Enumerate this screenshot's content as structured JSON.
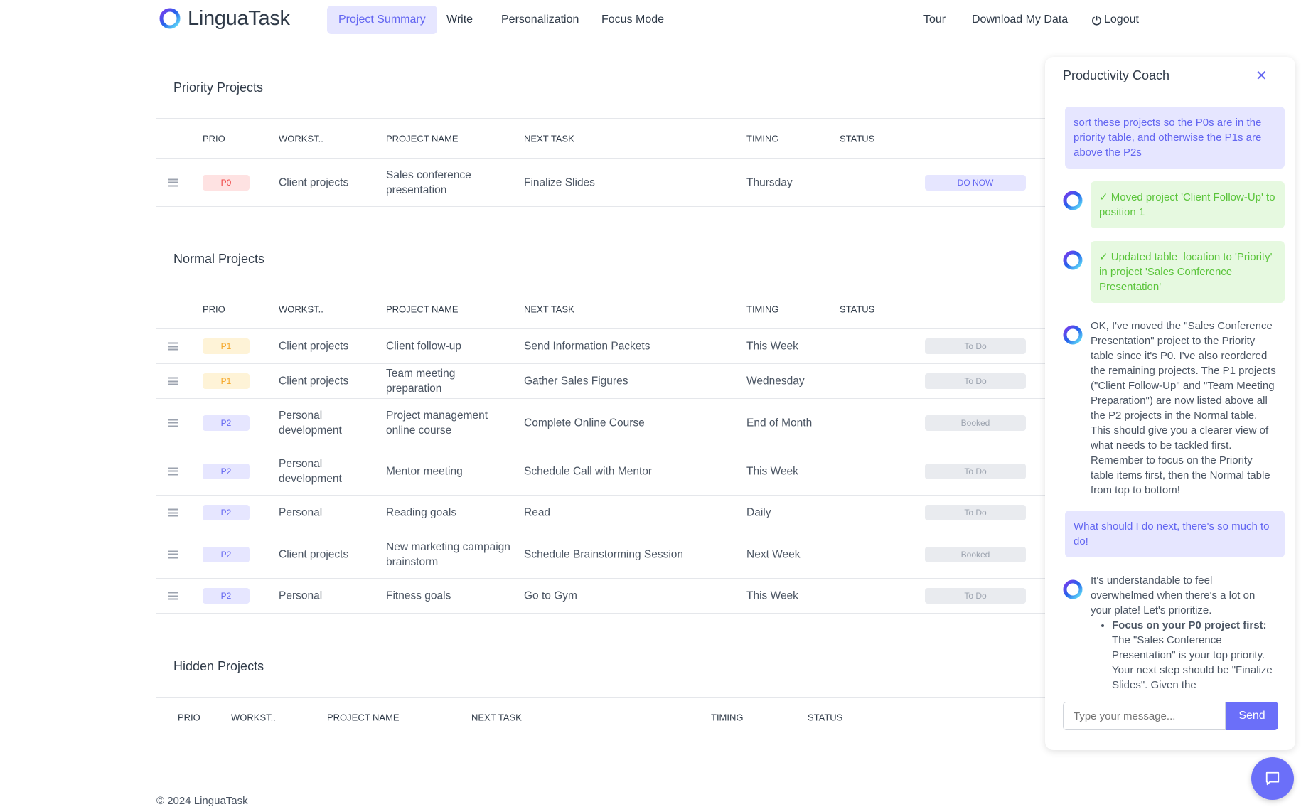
{
  "brand": {
    "name": "LinguaTask"
  },
  "nav": {
    "items": [
      "Project Summary",
      "Write",
      "Personalization",
      "Focus Mode"
    ],
    "active": "Project Summary",
    "right": {
      "tour": "Tour",
      "download": "Download My Data",
      "logout": "Logout"
    }
  },
  "columns": [
    "PRIO",
    "WORKST..",
    "PROJECT NAME",
    "NEXT TASK",
    "TIMING",
    "STATUS"
  ],
  "priority": {
    "title": "Priority Projects",
    "rows": [
      {
        "prio": "P0",
        "workstream": "Client projects",
        "project": "Sales conference presentation",
        "task": "Finalize Slides",
        "timing": "Thursday",
        "status": "DO NOW"
      }
    ]
  },
  "normal": {
    "title": "Normal Projects",
    "rows": [
      {
        "prio": "P1",
        "workstream": "Client projects",
        "project": "Client follow-up",
        "task": "Send Information Packets",
        "timing": "This Week",
        "status": "To Do"
      },
      {
        "prio": "P1",
        "workstream": "Client projects",
        "project": "Team meeting preparation",
        "task": "Gather Sales Figures",
        "timing": "Wednesday",
        "status": "To Do"
      },
      {
        "prio": "P2",
        "workstream": "Personal development",
        "project": "Project management online course",
        "task": "Complete Online Course",
        "timing": "End of Month",
        "status": "Booked"
      },
      {
        "prio": "P2",
        "workstream": "Personal development",
        "project": "Mentor meeting",
        "task": "Schedule Call with Mentor",
        "timing": "This Week",
        "status": "To Do"
      },
      {
        "prio": "P2",
        "workstream": "Personal",
        "project": "Reading goals",
        "task": "Read",
        "timing": "Daily",
        "status": "To Do"
      },
      {
        "prio": "P2",
        "workstream": "Client projects",
        "project": "New marketing campaign brainstorm",
        "task": "Schedule Brainstorming Session",
        "timing": "Next Week",
        "status": "Booked"
      },
      {
        "prio": "P2",
        "workstream": "Personal",
        "project": "Fitness goals",
        "task": "Go to Gym",
        "timing": "This Week",
        "status": "To Do"
      }
    ]
  },
  "hidden": {
    "title": "Hidden Projects",
    "rows": []
  },
  "colors": {
    "accent": "#6366f1",
    "p0_bg": "#fee2e2",
    "p0_fg": "#ef4444",
    "p1_bg": "#fef3d7",
    "p1_fg": "#f5a524",
    "p2_bg": "#e6e6ff",
    "p2_fg": "#6366f1",
    "success_bg": "#e6f9e0",
    "success_fg": "#5ac43a"
  },
  "chat": {
    "title": "Productivity Coach",
    "close_icon": "close-icon",
    "messages": [
      {
        "role": "user",
        "text": "sort these projects so the P0s are in the priority table, and otherwise the P1s are above the P2s"
      },
      {
        "role": "action",
        "text": "✓ Moved project 'Client Follow-Up' to position 1"
      },
      {
        "role": "action",
        "text": "✓ Updated table_location to 'Priority' in project 'Sales Conference Presentation'"
      },
      {
        "role": "bot",
        "text": "OK, I've moved the \"Sales Conference Presentation\" project to the Priority table since it's P0. I've also reordered the remaining projects. The P1 projects (\"Client Follow-Up\" and \"Team Meeting Preparation\") are now listed above all the P2 projects in the Normal table. This should give you a clearer view of what needs to be tackled first. Remember to focus on the Priority table items first, then the Normal table from top to bottom!"
      },
      {
        "role": "user",
        "text": "What should I do next, there's so much to do!"
      },
      {
        "role": "bot",
        "text": "It's understandable to feel overwhelmed when there's a lot on your plate! Let's prioritize.",
        "bullet_bold": "Focus on your P0 project first:",
        "bullet_text": " The \"Sales Conference Presentation\" is your top priority. Your next step should be \"Finalize Slides\". Given the"
      }
    ],
    "input_placeholder": "Type your message...",
    "send_label": "Send"
  },
  "footer": "© 2024 LinguaTask"
}
